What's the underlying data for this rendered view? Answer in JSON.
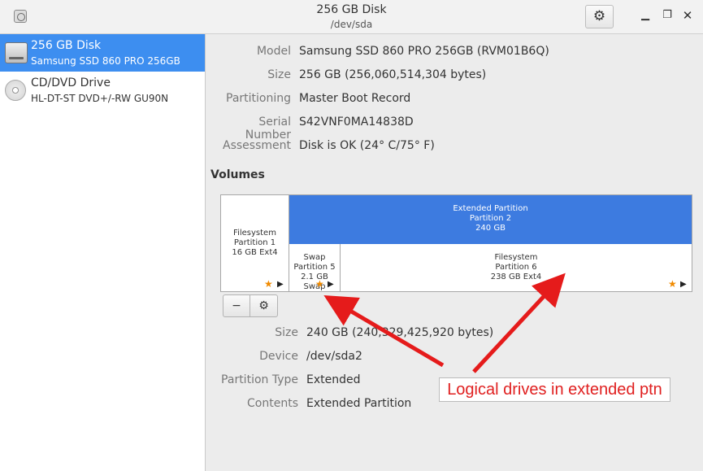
{
  "window": {
    "title": "256 GB Disk",
    "subtitle": "/dev/sda",
    "gear_icon": "gear-icon",
    "minimize": "▁",
    "maximize": "❐",
    "close": "✕"
  },
  "sidebar": {
    "items": [
      {
        "name": "256 GB Disk",
        "desc": "Samsung SSD 860 PRO 256GB",
        "icon": "hdd-icon",
        "selected": true
      },
      {
        "name": "CD/DVD Drive",
        "desc": "HL-DT-ST DVD+/-RW GU90N",
        "icon": "cd-icon",
        "selected": false
      }
    ]
  },
  "details": [
    {
      "label": "Model",
      "value": "Samsung SSD 860 PRO 256GB (RVM01B6Q)"
    },
    {
      "label": "Size",
      "value": "256 GB (256,060,514,304 bytes)"
    },
    {
      "label": "Partitioning",
      "value": "Master Boot Record"
    },
    {
      "label": "Serial Number",
      "value": "S42VNF0MA14838D"
    },
    {
      "label": "Assessment",
      "value": "Disk is OK (24° C/75° F)"
    }
  ],
  "volumes": {
    "title": "Volumes",
    "partitions": {
      "p1": {
        "line1": "Filesystem",
        "line2": "Partition 1",
        "line3": "16 GB Ext4"
      },
      "ext": {
        "line1": "Extended Partition",
        "line2": "Partition 2",
        "line3": "240 GB"
      },
      "p5": {
        "line1": "Swap",
        "line2": "Partition 5",
        "line3": "2.1 GB Swap"
      },
      "p6": {
        "line1": "Filesystem",
        "line2": "Partition 6",
        "line3": "238 GB Ext4"
      }
    },
    "star": "★",
    "play": "▶",
    "minus": "−",
    "settings": "⚙"
  },
  "selected_volume": [
    {
      "label": "Size",
      "value": "240 GB (240,329,425,920 bytes)"
    },
    {
      "label": "Device",
      "value": "/dev/sda2"
    },
    {
      "label": "Partition Type",
      "value": "Extended"
    },
    {
      "label": "Contents",
      "value": "Extended Partition"
    }
  ],
  "annotation": {
    "text": "Logical drives in extended ptn",
    "color": "#e02020"
  },
  "colors": {
    "selection": "#3d8ef0",
    "extended_partition": "#3d7be0",
    "star": "#f08a00"
  }
}
